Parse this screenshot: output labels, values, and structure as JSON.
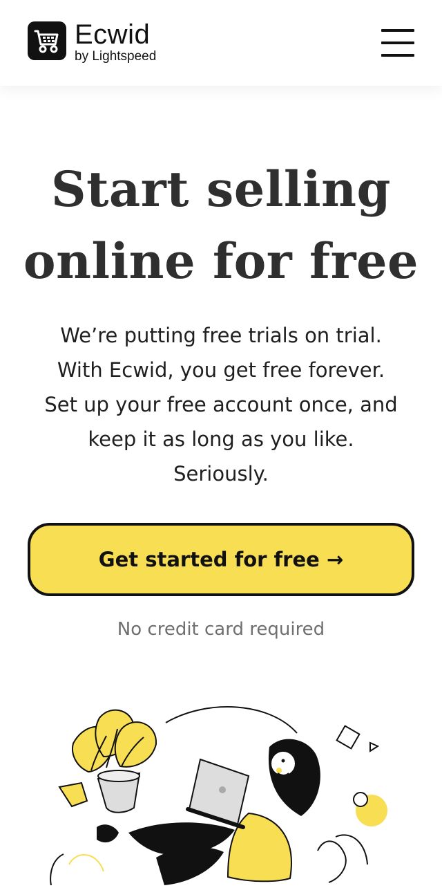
{
  "header": {
    "brand_name": "Ecwid",
    "brand_byline": "by Lightspeed",
    "menu_icon": "hamburger-menu-icon",
    "logo_icon": "shopping-cart-icon"
  },
  "hero": {
    "title_line1": "Start selling",
    "title_line2": "online for free",
    "subtitle_line1": "We’re putting free trials on trial.",
    "subtitle_line2": "With Ecwid, you get free forever.",
    "subtitle_line3": "Set up your free account once, and",
    "subtitle_line4": "keep it as long as you like.",
    "subtitle_line5": "Seriously."
  },
  "cta": {
    "label": "Get started for free →"
  },
  "note": "No credit card required",
  "colors": {
    "accent_yellow": "#f8de53",
    "text_dark": "#2f2f2f",
    "muted_text": "#6f6f6f",
    "border_black": "#111111"
  }
}
